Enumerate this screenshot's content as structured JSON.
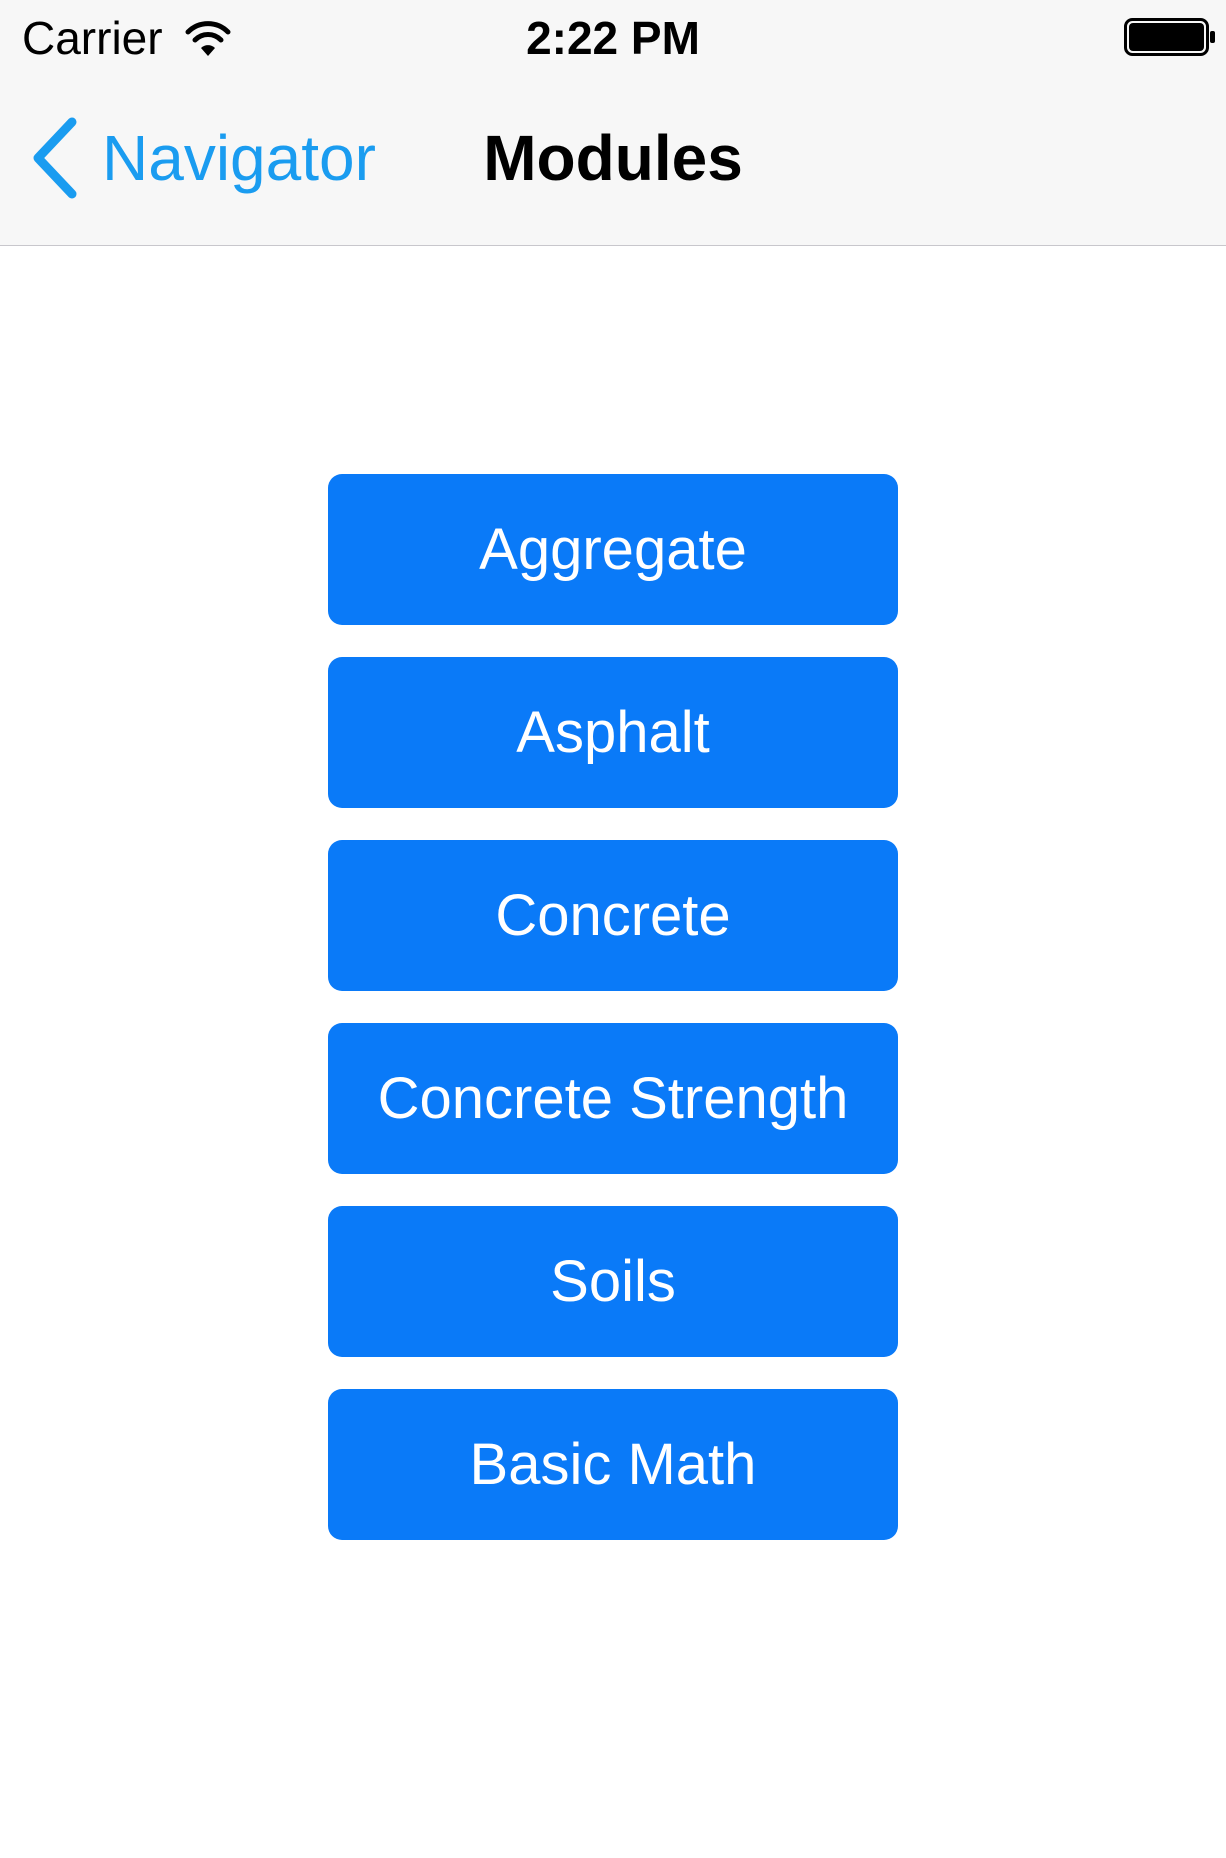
{
  "status_bar": {
    "carrier": "Carrier",
    "time": "2:22 PM",
    "wifi_icon": "wifi-icon",
    "battery_icon": "battery-icon"
  },
  "nav_bar": {
    "back_label": "Navigator",
    "back_icon": "chevron-left-icon",
    "title": "Modules"
  },
  "modules": [
    {
      "label": "Aggregate"
    },
    {
      "label": "Asphalt"
    },
    {
      "label": "Concrete"
    },
    {
      "label": "Concrete Strength"
    },
    {
      "label": "Soils"
    },
    {
      "label": "Basic Math"
    }
  ],
  "colors": {
    "accent": "#1a9cf0",
    "button_background": "#0a7af8",
    "button_text": "#ffffff",
    "nav_background": "#f7f7f7"
  }
}
